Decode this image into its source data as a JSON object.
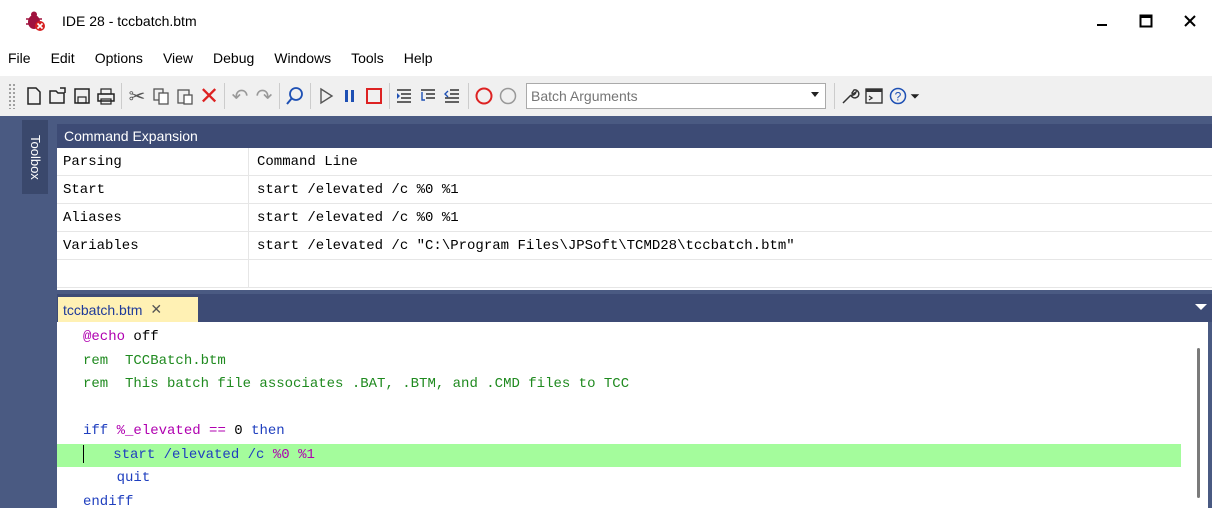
{
  "window": {
    "title": "IDE 28 - tccbatch.btm"
  },
  "menu": [
    "File",
    "Edit",
    "Options",
    "View",
    "Debug",
    "Windows",
    "Tools",
    "Help"
  ],
  "toolbar": {
    "batch_args_placeholder": "Batch Arguments"
  },
  "toolbox": {
    "label": "Toolbox"
  },
  "command_expansion": {
    "header": "Command Expansion",
    "rows": [
      {
        "name": "Parsing",
        "value": "Command Line"
      },
      {
        "name": "Start",
        "value": "start /elevated /c %0 %1"
      },
      {
        "name": "Aliases",
        "value": "start /elevated /c %0 %1"
      },
      {
        "name": "Variables",
        "value": "start /elevated /c \"C:\\Program Files\\JPSoft\\TCMD28\\tccbatch.btm\""
      },
      {
        "name": "",
        "value": ""
      }
    ]
  },
  "editor": {
    "tab_label": "tccbatch.btm",
    "tab_close": "✕",
    "lines": {
      "l1a": "@echo",
      "l1b": " off",
      "l2": "rem  TCCBatch.btm",
      "l3": "rem  This batch file associates .BAT, .BTM, and .CMD files to TCC",
      "l5a": "iff",
      "l5b": "%_elevated",
      "l5c": "==",
      "l5d": "0",
      "l5e": "then",
      "l6a": "start /elevated /c",
      "l6b": "%0 %1",
      "l7": "quit",
      "l8": "endiff"
    }
  },
  "colors": {
    "accent": "#3d4b75",
    "highlight": "#a4fc9c",
    "tab": "#fff1b4"
  }
}
